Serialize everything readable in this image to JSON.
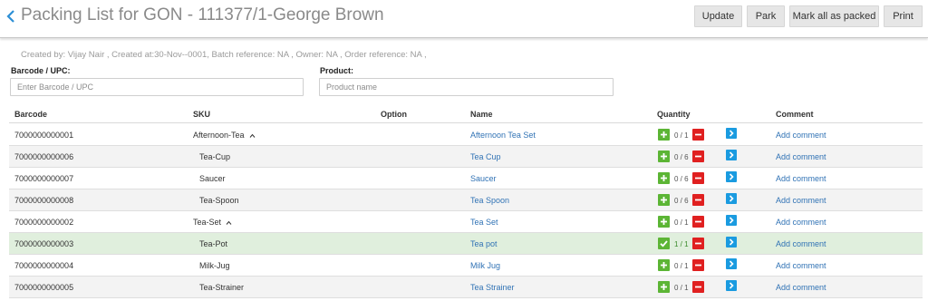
{
  "header": {
    "title": "Packing List for GON - 111377/1-George Brown",
    "buttons": {
      "update": "Update",
      "park": "Park",
      "mark_all": "Mark all as packed",
      "print": "Print"
    }
  },
  "meta": "Created by: Vijay Nair , Created at:30-Nov--0001, Batch reference: NA , Owner: NA , Order reference: NA ,",
  "filters": {
    "barcode_label": "Barcode / UPC:",
    "barcode_placeholder": "Enter Barcode / UPC",
    "product_label": "Product:",
    "product_placeholder": "Product name"
  },
  "table": {
    "columns": {
      "barcode": "Barcode",
      "sku": "SKU",
      "option": "Option",
      "name": "Name",
      "quantity": "Quantity",
      "comment": "Comment"
    },
    "rows": [
      {
        "barcode": "7000000000001",
        "sku": "Afternoon-Tea",
        "expandable": true,
        "name": "Afternoon Tea Set",
        "qty": "0 / 1",
        "packed": false,
        "comment": "Add comment"
      },
      {
        "barcode": "7000000000006",
        "sku": "Tea-Cup",
        "expandable": false,
        "name": "Tea Cup",
        "qty": "0 / 6",
        "packed": false,
        "comment": "Add comment"
      },
      {
        "barcode": "7000000000007",
        "sku": "Saucer",
        "expandable": false,
        "name": "Saucer",
        "qty": "0 / 6",
        "packed": false,
        "comment": "Add comment"
      },
      {
        "barcode": "7000000000008",
        "sku": "Tea-Spoon",
        "expandable": false,
        "name": "Tea Spoon",
        "qty": "0 / 6",
        "packed": false,
        "comment": "Add comment"
      },
      {
        "barcode": "7000000000002",
        "sku": "Tea-Set",
        "expandable": true,
        "name": "Tea Set",
        "qty": "0 / 1",
        "packed": false,
        "comment": "Add comment"
      },
      {
        "barcode": "7000000000003",
        "sku": "Tea-Pot",
        "expandable": false,
        "name": "Tea pot",
        "qty": "1 / 1",
        "packed": true,
        "comment": "Add comment"
      },
      {
        "barcode": "7000000000004",
        "sku": "Milk-Jug",
        "expandable": false,
        "name": "Milk Jug",
        "qty": "0 / 1",
        "packed": false,
        "comment": "Add comment"
      },
      {
        "barcode": "7000000000005",
        "sku": "Tea-Strainer",
        "expandable": false,
        "name": "Tea Strainer",
        "qty": "0 / 1",
        "packed": false,
        "comment": "Add comment"
      }
    ]
  },
  "colors": {
    "accent": "#3173b5",
    "plus": "#5cb535",
    "minus": "#e02020",
    "go": "#1a9be0",
    "packed_row": "#e0efdd"
  },
  "icons": {
    "back": "chevron-left-icon",
    "plus": "plus-icon",
    "minus": "minus-icon",
    "check": "check-icon",
    "go": "chevron-right-icon",
    "expand": "caret-up-icon"
  }
}
